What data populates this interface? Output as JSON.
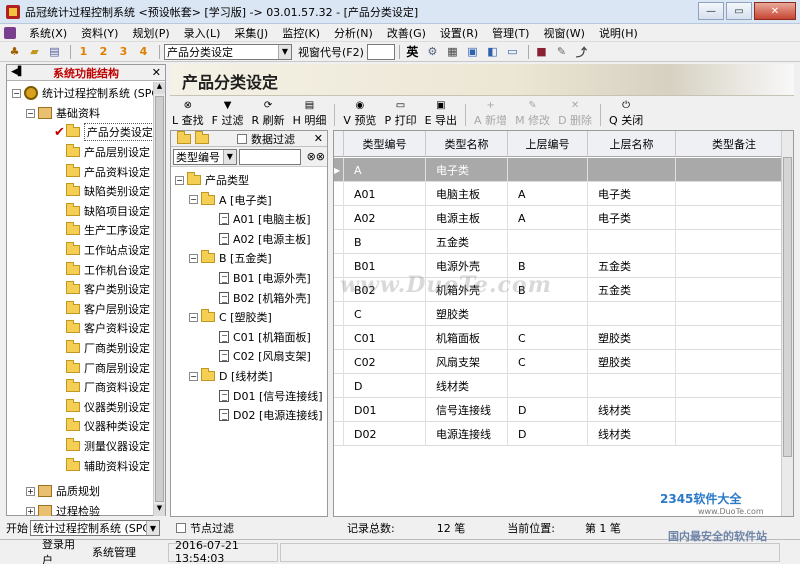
{
  "window": {
    "title": "品冠统计过程控制系统 <预设帐套> [学习版] -> 03.01.57.32 - [产品分类设定]"
  },
  "menu": [
    "系统(X)",
    "资料(Y)",
    "规划(P)",
    "录入(L)",
    "采集(J)",
    "监控(K)",
    "分析(N)",
    "改善(G)",
    "设置(R)",
    "管理(T)",
    "视窗(W)",
    "说明(H)"
  ],
  "toolbar": {
    "num_labels": [
      "1",
      "2",
      "3",
      "4"
    ],
    "module_select": "产品分类设定",
    "window_code_label": "视窗代号(F2)",
    "window_code_value": "",
    "lang_label": "英"
  },
  "sidebar": {
    "title": "系统功能结构",
    "root": "统计过程控制系统 (SPC)",
    "group": "基础资料",
    "selected": "产品分类设定",
    "items": [
      "产品层别设定",
      "产品资料设定",
      "缺陷类别设定",
      "缺陷项目设定",
      "生产工序设定",
      "工作站点设定",
      "工作机台设定",
      "客户类别设定",
      "客户层别设定",
      "客户资料设定",
      "厂商类别设定",
      "厂商层别设定",
      "厂商资料设定",
      "仪器类别设定",
      "仪器种类设定",
      "测量仪器设定",
      "辅助资料设定"
    ],
    "collapsed_groups": [
      "品质规划",
      "过程检验"
    ],
    "footer_label": "开始",
    "footer_select": "统计过程控制系统 (SPC)"
  },
  "main": {
    "title": "产品分类设定",
    "actions": [
      {
        "key": "L",
        "label": "查找",
        "icon": "binoculars-icon",
        "enabled": true
      },
      {
        "key": "F",
        "label": "过滤",
        "icon": "filter-icon",
        "enabled": true
      },
      {
        "key": "R",
        "label": "刷新",
        "icon": "refresh-icon",
        "enabled": true
      },
      {
        "key": "H",
        "label": "明细",
        "icon": "detail-icon",
        "enabled": true
      },
      {
        "key": "V",
        "label": "预览",
        "icon": "preview-icon",
        "enabled": true
      },
      {
        "key": "P",
        "label": "打印",
        "icon": "printer-icon",
        "enabled": true
      },
      {
        "key": "E",
        "label": "导出",
        "icon": "export-icon",
        "enabled": true
      },
      {
        "key": "A",
        "label": "新增",
        "icon": "add-icon",
        "enabled": false
      },
      {
        "key": "M",
        "label": "修改",
        "icon": "edit-icon",
        "enabled": false
      },
      {
        "key": "D",
        "label": "删除",
        "icon": "delete-icon",
        "enabled": false
      },
      {
        "key": "Q",
        "label": "关闭",
        "icon": "close-icon",
        "enabled": true
      }
    ]
  },
  "product_tree": {
    "filter_label": "数据过滤",
    "search_field": "类型编号",
    "search_value": "",
    "root": "产品类型",
    "groups": [
      {
        "label": "A [电子类]",
        "children": [
          "A01 [电脑主板]",
          "A02 [电源主板]"
        ]
      },
      {
        "label": "B [五金类]",
        "children": [
          "B01 [电源外壳]",
          "B02 [机箱外壳]"
        ]
      },
      {
        "label": "C [塑胶类]",
        "children": [
          "C01 [机箱面板]",
          "C02 [风扇支架]"
        ]
      },
      {
        "label": "D [线材类]",
        "children": [
          "D01 [信号连接线]",
          "D02 [电源连接线]"
        ]
      }
    ],
    "footer_label": "节点过滤"
  },
  "grid": {
    "columns": [
      "类型编号",
      "类型名称",
      "上层编号",
      "上层名称",
      "类型备注"
    ],
    "rows": [
      [
        "A",
        "电子类",
        "",
        "",
        ""
      ],
      [
        "A01",
        "电脑主板",
        "A",
        "电子类",
        ""
      ],
      [
        "A02",
        "电源主板",
        "A",
        "电子类",
        ""
      ],
      [
        "B",
        "五金类",
        "",
        "",
        ""
      ],
      [
        "B01",
        "电源外壳",
        "B",
        "五金类",
        ""
      ],
      [
        "B02",
        "机箱外壳",
        "B",
        "五金类",
        ""
      ],
      [
        "C",
        "塑胶类",
        "",
        "",
        ""
      ],
      [
        "C01",
        "机箱面板",
        "C",
        "塑胶类",
        ""
      ],
      [
        "C02",
        "风扇支架",
        "C",
        "塑胶类",
        ""
      ],
      [
        "D",
        "线材类",
        "",
        "",
        ""
      ],
      [
        "D01",
        "信号连接线",
        "D",
        "线材类",
        ""
      ],
      [
        "D02",
        "电源连接线",
        "D",
        "线材类",
        ""
      ]
    ],
    "selected_index": 0,
    "total_label": "记录总数:",
    "total_value": "12 笔",
    "position_label": "当前位置:",
    "position_value": "第 1 笔"
  },
  "status": {
    "user_label": "登录用户",
    "user_value": "系统管理",
    "datetime": "2016-07-21 13:54:03"
  },
  "watermark": {
    "center": "www.DuoTe.com",
    "logo": "2345软件大全",
    "url": "www.DuoTe.com",
    "slogan": "国内最安全的软件站"
  }
}
